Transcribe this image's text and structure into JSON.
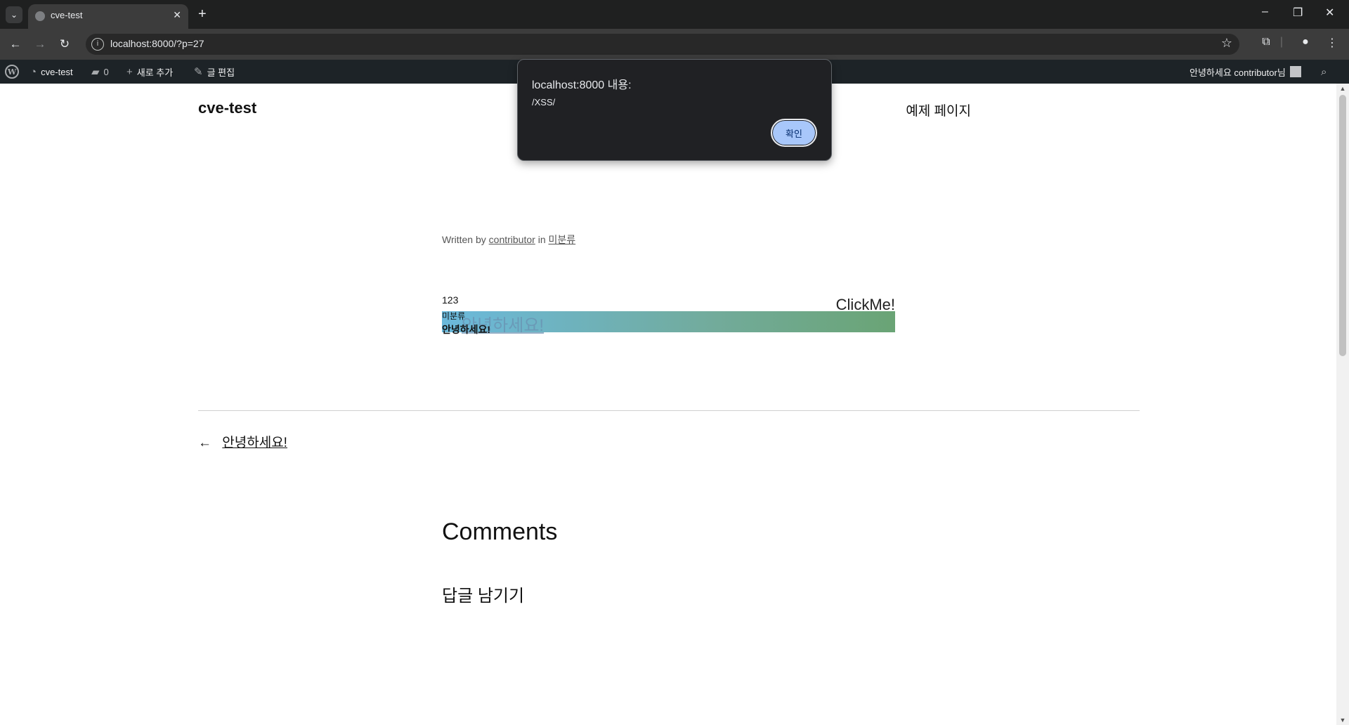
{
  "browser": {
    "tab_title": "cve-test",
    "url": "localhost:8000/?p=27"
  },
  "adminbar": {
    "site_name": "cve-test",
    "comments_count": "0",
    "new_label": "새로 추가",
    "edit_label": "글 편집",
    "greeting": "안녕하세요 contributor님"
  },
  "site": {
    "title": "cve-test",
    "nav_link": "예제 페이지"
  },
  "post": {
    "byline_written_by": "Written by",
    "author": "contributor",
    "byline_in": "in",
    "category": "미분류",
    "number": "123",
    "clickme": "ClickMe!",
    "category_small": "미분류",
    "ghost_link": "안녕하세요!",
    "bold_text": "안녕하세요!"
  },
  "post_nav": {
    "arrow": "←",
    "prev_title": "안녕하세요!"
  },
  "comments": {
    "title": "Comments",
    "reply_title": "답글 남기기"
  },
  "dialog": {
    "heading": "localhost:8000 내용:",
    "message": "/XSS/",
    "ok_label": "확인"
  }
}
